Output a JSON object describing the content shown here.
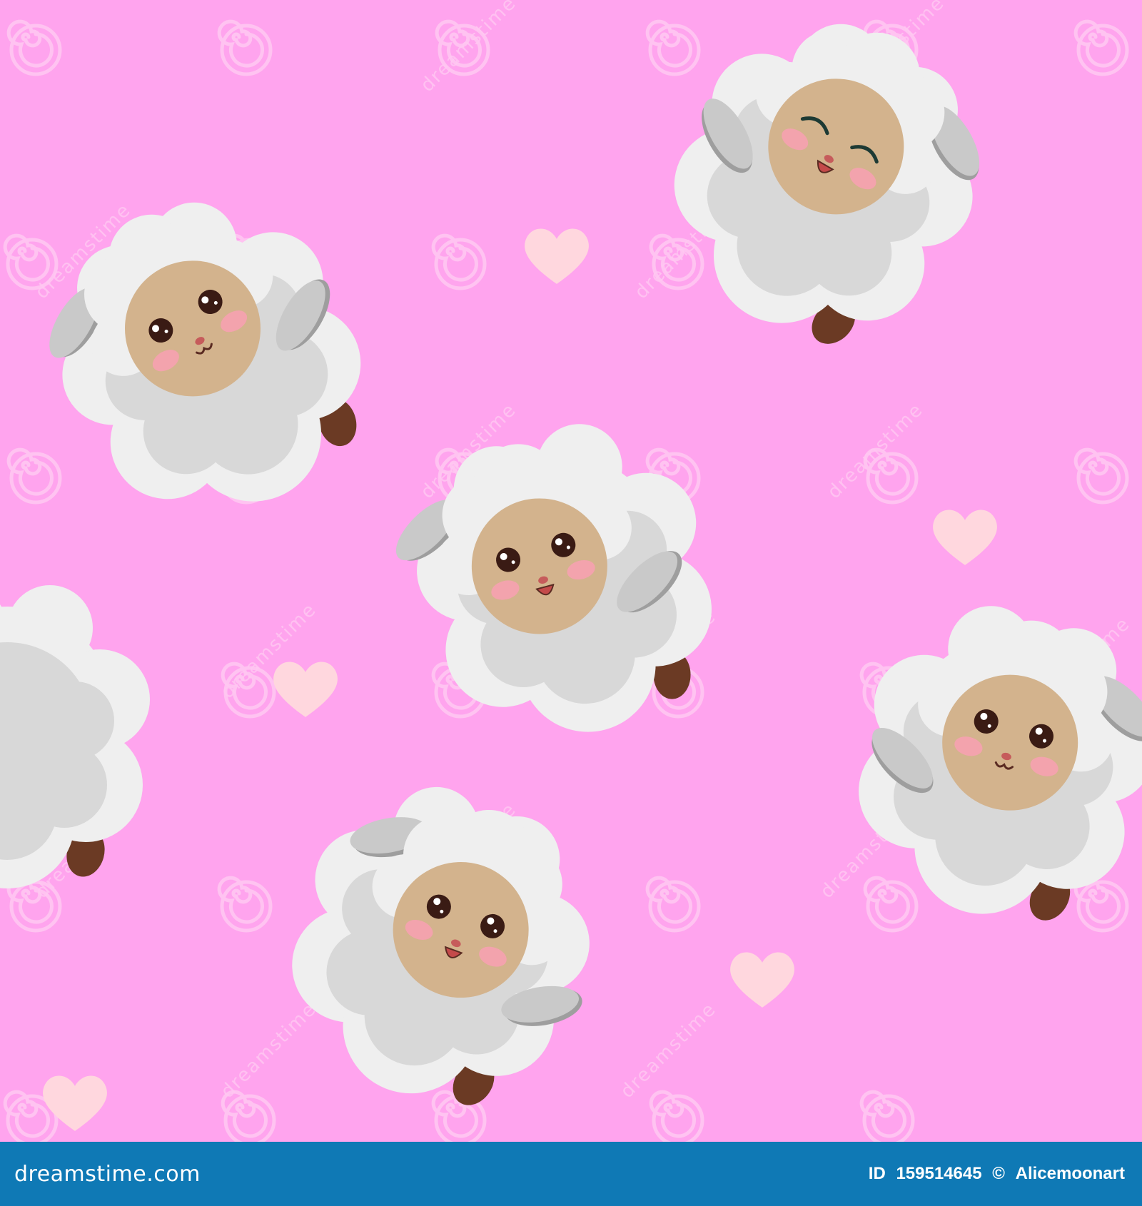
{
  "colors": {
    "background": "#ffa4ee",
    "footer": "#0f79b5",
    "wool_light": "#efefef",
    "wool_dark": "#d8d8d8",
    "face": "#d3b38d",
    "ear": "#c9c9c9",
    "ear_shadow": "#9e9e9e",
    "hoof": "#6b3a24",
    "blush": "#f3a3ad",
    "eye": "#3a1b14",
    "heart": "#ffd7de",
    "watermark": "#ffc9f2"
  },
  "watermark": {
    "text": "dreamstime",
    "icon": "swirl-icon"
  },
  "footer": {
    "brand": "dreamstime.com",
    "id_label": "ID",
    "id_value": "159514645",
    "copyright": "©",
    "author": "Alicemoonart"
  },
  "sheep": [
    {
      "name": "sheep-top-left",
      "expression": "smiling"
    },
    {
      "name": "sheep-top-right",
      "expression": "winking"
    },
    {
      "name": "sheep-center",
      "expression": "open-mouth"
    },
    {
      "name": "sheep-left-edge",
      "expression": "partial"
    },
    {
      "name": "sheep-right-middle",
      "expression": "smiling"
    },
    {
      "name": "sheep-bottom-center",
      "expression": "open-mouth"
    }
  ]
}
